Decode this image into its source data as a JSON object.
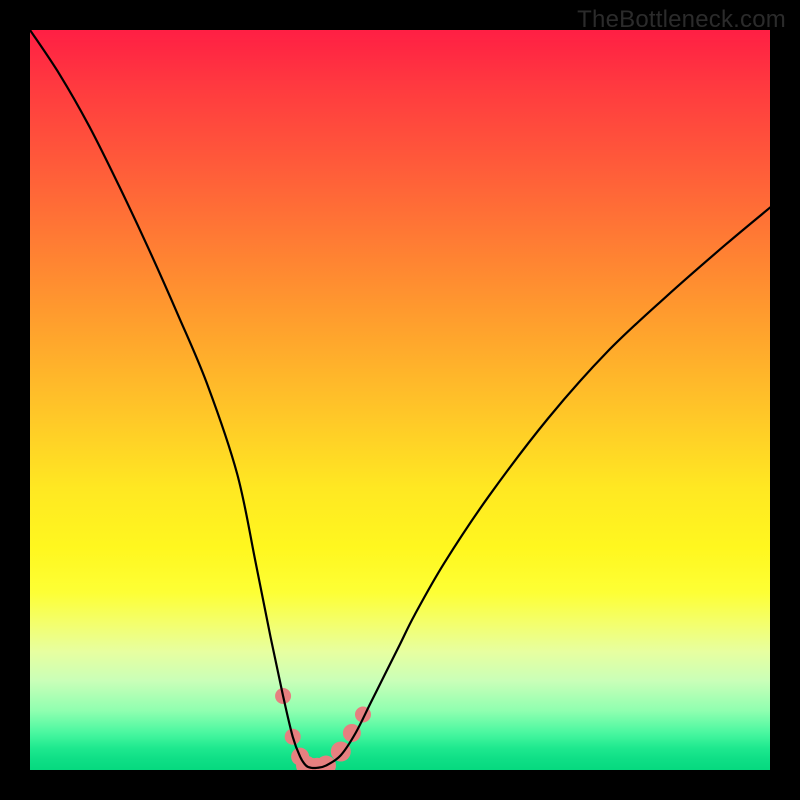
{
  "watermark": {
    "text": "TheBottleneck.com"
  },
  "colors": {
    "background": "#000000",
    "curve_stroke": "#000000",
    "marker_fill": "#e68080",
    "marker_stroke": "#e68080"
  },
  "chart_data": {
    "type": "line",
    "title": "",
    "xlabel": "",
    "ylabel": "",
    "xlim": [
      0,
      100
    ],
    "ylim": [
      0,
      100
    ],
    "grid": false,
    "legend": false,
    "description": "Bottleneck percentage curve on rainbow gradient background. Curve descends from top-left, reaches a flat minimum near the bottom center (optimal pairing), then ascends toward the right edge. Small salmon-colored markers highlight the near-minimum region.",
    "series": [
      {
        "name": "bottleneck-curve",
        "x": [
          0,
          4,
          8,
          12,
          16,
          20,
          24,
          28,
          30.5,
          32.5,
          34.2,
          35.5,
          36.5,
          37.3,
          38.0,
          38.8,
          40.0,
          42.0,
          44.0,
          46.0,
          48.0,
          50.0,
          52.0,
          56.0,
          62.0,
          70.0,
          78.0,
          86.0,
          94.0,
          100.0
        ],
        "y": [
          100,
          94,
          87,
          79,
          70.5,
          61.5,
          52,
          40,
          28,
          18,
          10,
          4.5,
          1.8,
          0.6,
          0.3,
          0.3,
          0.6,
          2.0,
          5.0,
          9.0,
          13.0,
          17.0,
          21.0,
          28.0,
          37.0,
          47.5,
          56.5,
          64.0,
          71.0,
          76.0
        ]
      }
    ],
    "markers": {
      "name": "near-optimal-points",
      "x": [
        34.2,
        35.5,
        36.5,
        37.3,
        38.0,
        38.8,
        40.0,
        42.0,
        43.5,
        45.0
      ],
      "y": [
        10.0,
        4.5,
        1.8,
        0.6,
        0.3,
        0.3,
        0.6,
        2.5,
        5.0,
        7.5
      ],
      "r": [
        8,
        8,
        9,
        10,
        10,
        10,
        10,
        10,
        9,
        8
      ]
    }
  }
}
